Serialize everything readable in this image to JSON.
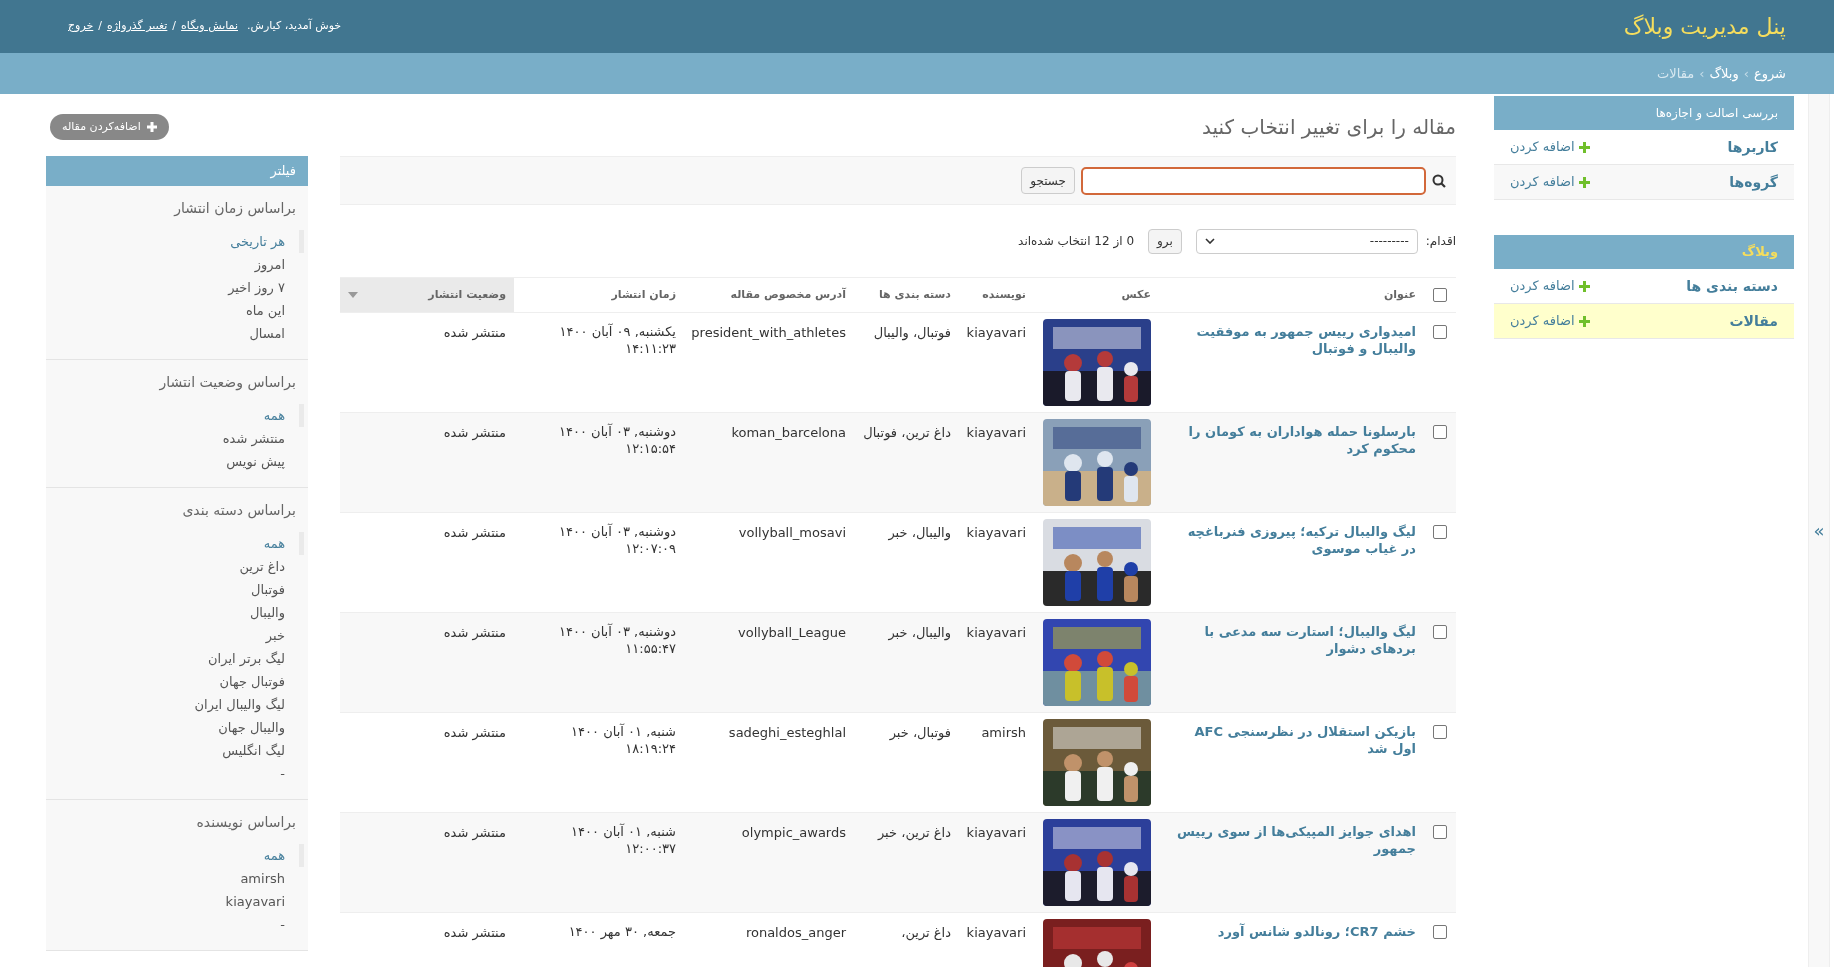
{
  "header": {
    "title": "پنل مدیریت وبلاگ",
    "user_tools": [
      {
        "kind": "text",
        "text": "خوش آمدید، کیارش."
      },
      {
        "kind": "link",
        "text": "نمایش وبگاه"
      },
      {
        "kind": "sep",
        "text": "/"
      },
      {
        "kind": "link",
        "text": "تغییر گذرواژه"
      },
      {
        "kind": "sep",
        "text": "/"
      },
      {
        "kind": "link",
        "text": "خروج"
      }
    ]
  },
  "breadcrumbs": [
    {
      "kind": "link",
      "text": "شروع"
    },
    {
      "kind": "sep",
      "text": "›"
    },
    {
      "kind": "link",
      "text": "وبلاگ"
    },
    {
      "kind": "sep",
      "text": "›"
    },
    {
      "kind": "current",
      "text": "مقالات"
    }
  ],
  "nav": {
    "modules": [
      {
        "caption": "بررسی اصالت و اجازه‌ها",
        "current": false,
        "models": [
          {
            "name": "کاربرها",
            "add": "اضافه کردن",
            "selected": false
          },
          {
            "name": "گروه‌ها",
            "add": "اضافه کردن",
            "selected": false
          }
        ]
      },
      {
        "caption": "وبلاگ",
        "current": true,
        "models": [
          {
            "name": "دسته بندی ها",
            "add": "اضافه کردن",
            "selected": false
          },
          {
            "name": "مقالات",
            "add": "اضافه کردن",
            "selected": true
          }
        ]
      }
    ],
    "toggle": "»"
  },
  "content": {
    "title": "مقاله را برای تغییر انتخاب کنید",
    "add_button": "اضافه‌کردن مقاله",
    "search": {
      "button": "جستجو"
    },
    "actions": {
      "label": "اقدام:",
      "select_value": "---------",
      "go": "برو",
      "counter": "0 از 12 انتخاب شده‌اند"
    },
    "table": {
      "select_all": {
        "checked": false
      },
      "columns": [
        {
          "label": "عنوان",
          "sorted": false
        },
        {
          "label": "عکس",
          "sorted": false
        },
        {
          "label": "نویسنده",
          "sorted": false
        },
        {
          "label": "دسته بندی ها",
          "sorted": false
        },
        {
          "label": "آدرس مخصوص مقاله",
          "sorted": false
        },
        {
          "label": "زمان انتشار",
          "sorted": false
        },
        {
          "label": "وضعیت انتشار",
          "sorted": true
        }
      ],
      "rows": [
        {
          "checked": false,
          "title": "امیدواری رییس جمهور به موفقیت والیبال و فوتبال",
          "author": "kiayavari",
          "categories": "فوتبال، والیبال",
          "slug": "president_with_athletes",
          "published": "یکشنبه, ۰۹ آبان ۱۴۰۰\n۱۴:۱۱:۲۳",
          "status": "منتشر شده"
        },
        {
          "checked": false,
          "title": "بارسلونا حمله هواداران به کومان را محکوم کرد",
          "author": "kiayavari",
          "categories": "داغ ترین، فوتبال",
          "slug": "koman_barcelona",
          "published": "دوشنبه, ۰۳ آبان ۱۴۰۰\n۱۲:۱۵:۵۴",
          "status": "منتشر شده"
        },
        {
          "checked": false,
          "title": "لیگ والیبال ترکیه؛ پیروزی فنرباغچه در غیاب موسوی",
          "author": "kiayavari",
          "categories": "والیبال، خبر",
          "slug": "vollyball_mosavi",
          "published": "دوشنبه, ۰۳ آبان ۱۴۰۰\n۱۲:۰۷:۰۹",
          "status": "منتشر شده"
        },
        {
          "checked": false,
          "title": "لیگ والیبال؛ استارت سه مدعی با بردهای دشوار",
          "author": "kiayavari",
          "categories": "والیبال، خبر",
          "slug": "vollyball_League",
          "published": "دوشنبه, ۰۳ آبان ۱۴۰۰\n۱۱:۵۵:۴۷",
          "status": "منتشر شده"
        },
        {
          "checked": false,
          "title": "بازیکن استقلال در نظرسنجی AFC اول شد",
          "author": "amirsh",
          "categories": "فوتبال، خبر",
          "slug": "sadeghi_esteghlal",
          "published": "شنبه, ۰۱ آبان ۱۴۰۰\n۱۸:۱۹:۲۴",
          "status": "منتشر شده"
        },
        {
          "checked": false,
          "title": "اهدای جوایز المپیکی‌ها از سوی رییس جمهور",
          "author": "kiayavari",
          "categories": "داغ ترین، خبر",
          "slug": "olympic_awards",
          "published": "شنبه, ۰۱ آبان ۱۴۰۰\n۱۲:۰۰:۳۷",
          "status": "منتشر شده"
        },
        {
          "checked": false,
          "title": "خشم CR7؛ رونالدو شانس آورد",
          "author": "kiayavari",
          "categories": "داغ ترین،",
          "slug": "ronaldos_anger",
          "published": "جمعه, ۳۰ مهر ۱۴۰۰",
          "status": "منتشر شده"
        }
      ]
    }
  },
  "filter": {
    "title": "فیلتر",
    "sections": [
      {
        "title": "براساس زمان انتشار",
        "items": [
          {
            "text": "هر تاریخی",
            "selected": true
          },
          {
            "text": "امروز",
            "selected": false
          },
          {
            "text": "۷ روز اخیر",
            "selected": false
          },
          {
            "text": "این ماه",
            "selected": false
          },
          {
            "text": "امسال",
            "selected": false
          }
        ]
      },
      {
        "title": "براساس وضعیت انتشار",
        "items": [
          {
            "text": "همه",
            "selected": true
          },
          {
            "text": "منتشر شده",
            "selected": false
          },
          {
            "text": "پیش نویس",
            "selected": false
          }
        ]
      },
      {
        "title": "براساس دسته بندی",
        "items": [
          {
            "text": "همه",
            "selected": true
          },
          {
            "text": "داغ ترین",
            "selected": false
          },
          {
            "text": "فوتبال",
            "selected": false
          },
          {
            "text": "والیبال",
            "selected": false
          },
          {
            "text": "خبر",
            "selected": false
          },
          {
            "text": "لیگ برتر ایران",
            "selected": false
          },
          {
            "text": "فوتبال جهان",
            "selected": false
          },
          {
            "text": "لیگ والیبال ایران",
            "selected": false
          },
          {
            "text": "والیبال جهان",
            "selected": false
          },
          {
            "text": "لیگ انگلیس",
            "selected": false
          },
          {
            "text": "-",
            "selected": false
          }
        ]
      },
      {
        "title": "براساس نویسنده",
        "items": [
          {
            "text": "همه",
            "selected": true
          },
          {
            "text": "amirsh",
            "selected": false
          },
          {
            "text": "kiayavari",
            "selected": false
          },
          {
            "text": "-",
            "selected": false
          }
        ]
      }
    ]
  }
}
